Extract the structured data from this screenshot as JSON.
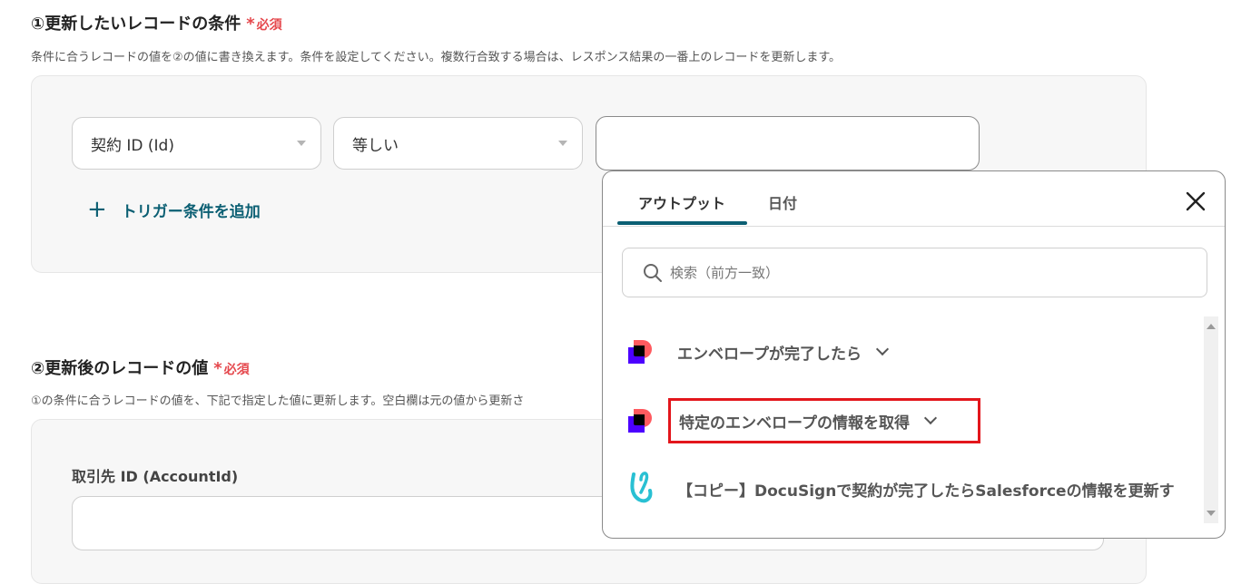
{
  "section1": {
    "title": "①更新したいレコードの条件",
    "required": "必須",
    "description": "条件に合うレコードの値を②の値に書き換えます。条件を設定してください。複数行合致する場合は、レスポンス結果の一番上のレコードを更新します。",
    "field_select": "契約 ID (Id)",
    "operator_select": "等しい",
    "value_input": "",
    "add_condition": "トリガー条件を追加"
  },
  "section2": {
    "title": "②更新後のレコードの値",
    "required": "必須",
    "description": "①の条件に合うレコードの値を、下記で指定した値に更新します。空白欄は元の値から更新さ",
    "field_label": "取引先 ID (AccountId)",
    "field_value": ""
  },
  "popup": {
    "tabs": [
      {
        "label": "アウトプット",
        "active": true
      },
      {
        "label": "日付",
        "active": false
      }
    ],
    "search_placeholder": "検索（前方一致）",
    "items": [
      {
        "label": "エンベロープが完了したら",
        "icon": "docusign-icon",
        "expandable": true,
        "highlighted": false
      },
      {
        "label": "特定のエンベロープの情報を取得",
        "icon": "docusign-icon",
        "expandable": true,
        "highlighted": true
      },
      {
        "label": "【コピー】DocuSignで契約が完了したらSalesforceの情報を更新す",
        "icon": "yoom-icon",
        "expandable": false,
        "highlighted": false
      }
    ],
    "colors": {
      "accent": "#0b5f73",
      "highlight": "#e3161c",
      "required": "#e5484d"
    }
  }
}
